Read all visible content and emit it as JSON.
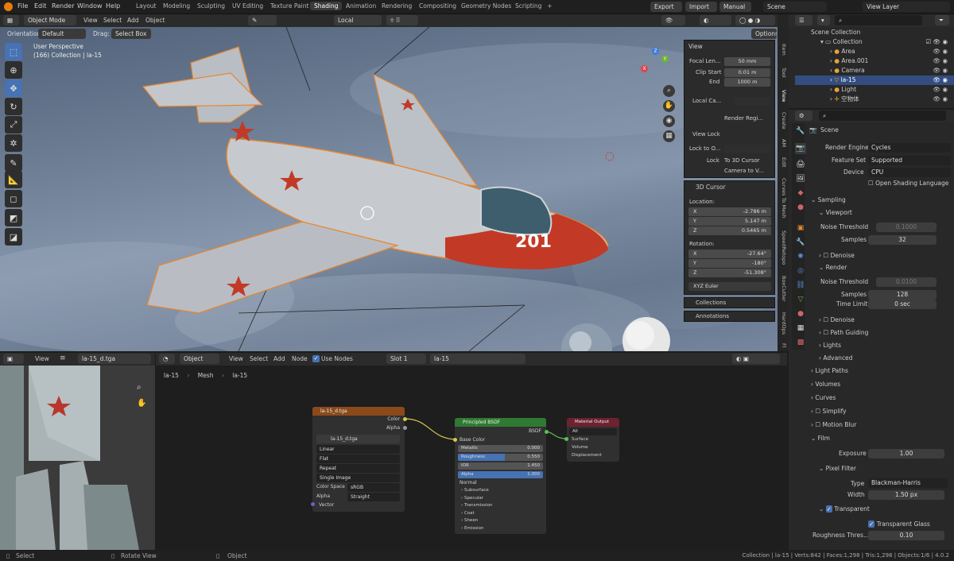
{
  "menubar": {
    "file": "File",
    "edit": "Edit",
    "render": "Render",
    "window": "Window",
    "help": "Help",
    "workspaces": [
      "Layout",
      "Modeling",
      "Sculpting",
      "UV Editing",
      "Texture Paint",
      "Shading",
      "Animation",
      "Rendering",
      "Compositing",
      "Geometry Nodes",
      "Scripting"
    ],
    "export": "Export",
    "import": "Import",
    "manual": "Manual",
    "scene": "Scene",
    "view_layer": "View Layer"
  },
  "viewport": {
    "mode": "Object Mode",
    "menu": [
      "View",
      "Select",
      "Add",
      "Object"
    ],
    "orientation_label": "Orientation:",
    "orientation": "Default",
    "drag_label": "Drag:",
    "drag": "Select Box",
    "transform": "Local",
    "options": "Options",
    "perspective": "User Perspective",
    "collection_info": "(166) Collection | la-15",
    "number": "201"
  },
  "npanel": {
    "view_title": "View",
    "focal_label": "Focal Len...",
    "focal": "50 mm",
    "clip_start_label": "Clip Start",
    "clip_start": "0.01 m",
    "end_label": "End",
    "end": "1000 m",
    "local_cam_label": "Local Ca...",
    "render_region": "Render Regi...",
    "view_lock": "View Lock",
    "lock_to_label": "Lock to O...",
    "lock_label": "Lock",
    "to_3d_cursor": "To 3D Cursor",
    "camera_to_view": "Camera to V...",
    "cursor_title": "3D Cursor",
    "location_label": "Location:",
    "x_label": "X",
    "y_label": "Y",
    "z_label": "Z",
    "loc_x": "-2.786 m",
    "loc_y": "5.147 m",
    "loc_z": "0.5465 m",
    "rotation_label": "Rotation:",
    "rot_x": "-27.64°",
    "rot_y": "-180°",
    "rot_z": "-51.308°",
    "rot_mode": "XYZ Euler",
    "collections": "Collections",
    "annotations": "Annotations"
  },
  "sidetabs": [
    "Item",
    "Tool",
    "View",
    "Create",
    "AM",
    "Edit",
    "Curves To Mesh",
    "SpeedRetopo",
    "BoxCutter",
    "HardOps",
    "Fl"
  ],
  "image_editor": {
    "view": "View",
    "image": "la-15_d.tga"
  },
  "node_editor": {
    "object": "Object",
    "menu": [
      "View",
      "Select",
      "Add",
      "Node"
    ],
    "use_nodes": "Use Nodes",
    "slot": "Slot 1",
    "material": "la-15",
    "bc_object": "la-15",
    "bc_mesh": "Mesh",
    "bc_material": "la-15",
    "tex": {
      "title": "la-15_d.tga",
      "color": "Color",
      "alpha": "Alpha",
      "image": "la-15_d.tga",
      "interp": "Linear",
      "proj": "Flat",
      "ext": "Repeat",
      "source": "Single Image",
      "cs_label": "Color Space",
      "cs": "sRGB",
      "alpha_label": "Alpha",
      "alpha_mode": "Straight",
      "vector": "Vector"
    },
    "bsdf": {
      "title": "Principled BSDF",
      "out": "BSDF",
      "base_color": "Base Color",
      "metallic": "Metallic",
      "metallic_v": "0.000",
      "roughness": "Roughness",
      "roughness_v": "0.550",
      "ior": "IOR",
      "ior_v": "1.450",
      "alpha": "Alpha",
      "alpha_v": "1.000",
      "normal": "Normal",
      "subsurface": "Subsurface",
      "specular": "Specular",
      "transmission": "Transmission",
      "coat": "Coat",
      "sheen": "Sheen",
      "emission": "Emission"
    },
    "out": {
      "title": "Material Output",
      "target": "All",
      "surface": "Surface",
      "volume": "Volume",
      "displacement": "Displacement"
    }
  },
  "outliner": {
    "scene_collection": "Scene Collection",
    "items": [
      "Collection",
      "Area",
      "Area.001",
      "Camera",
      "la-15",
      "Light",
      "空物体"
    ]
  },
  "props": {
    "scene": "Scene",
    "render_engine_label": "Render Engine",
    "render_engine": "Cycles",
    "feature_set_label": "Feature Set",
    "feature_set": "Supported",
    "device_label": "Device",
    "device": "CPU",
    "osl": "Open Shading Language",
    "sampling": "Sampling",
    "viewport": "Viewport",
    "noise_threshold": "Noise Threshold",
    "vp_noise": "0.1000",
    "samples": "Samples",
    "vp_samples": "32",
    "denoise": "Denoise",
    "render": "Render",
    "r_noise": "0.0100",
    "r_samples": "128",
    "time_limit": "Time Limit",
    "r_time": "0 sec",
    "path_guiding": "Path Guiding",
    "lights": "Lights",
    "advanced": "Advanced",
    "light_paths": "Light Paths",
    "volumes": "Volumes",
    "curves": "Curves",
    "simplify": "Simplify",
    "motion_blur": "Motion Blur",
    "film": "Film",
    "exposure": "Exposure",
    "exposure_v": "1.00",
    "pixel_filter": "Pixel Filter",
    "type": "Type",
    "type_v": "Blackman-Harris",
    "width": "Width",
    "width_v": "1.50 px",
    "transparent": "Transparent",
    "transparent_glass": "Transparent Glass",
    "roughness_thresh": "Roughness Thres...",
    "roughness_thresh_v": "0.10"
  },
  "status": {
    "select": "Select",
    "rotate": "Rotate View",
    "object": "Object",
    "info": "Collection | la-15 | Verts:842 | Faces:1,298 | Tris:1,298 | Objects:1/6 | 4.0.2"
  }
}
